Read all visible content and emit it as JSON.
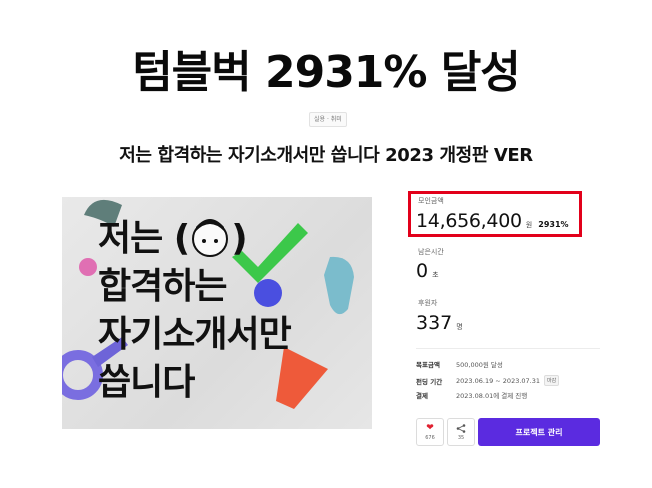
{
  "headline": "텀블벅 2931% 달성",
  "category": "실용 · 취미",
  "project_title": "저는 합격하는 자기소개서만 씁니다 2023 개정판 VER",
  "hero_text": [
    "저는 (",
    "합격하는",
    "자기소개서만",
    "씁니다"
  ],
  "hero_text_tail": ")",
  "funding": {
    "amount_label": "모인금액",
    "amount": "14,656,400",
    "amount_unit": "원",
    "percent": "2931%",
    "time_label": "남은시간",
    "time_value": "0",
    "time_unit": "초",
    "supporters_label": "후원자",
    "supporters_value": "337",
    "supporters_unit": "명"
  },
  "info": {
    "goal_key": "목표금액",
    "goal_value": "500,000원 달성",
    "period_key": "펀딩 기간",
    "period_value": "2023.06.19 ~ 2023.07.31",
    "period_badge": "마감",
    "payment_key": "결제",
    "payment_value": "2023.08.01에 결제 진행"
  },
  "actions": {
    "like_count": "676",
    "share_count": "35",
    "manage_label": "프로젝트 관리"
  },
  "colors": {
    "accent": "#5b2be0",
    "highlight_box": "#e2001a",
    "heart": "#e02030"
  },
  "icons": {
    "like": "heart-icon",
    "share": "share-icon"
  }
}
